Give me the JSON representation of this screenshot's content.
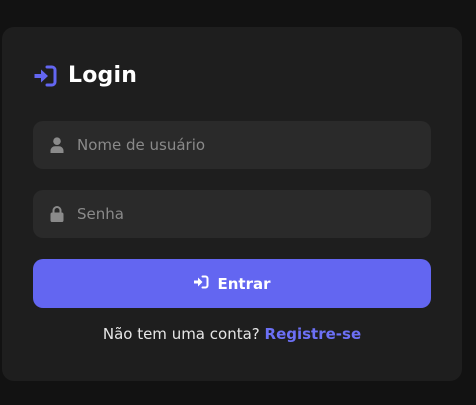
{
  "login": {
    "title": "Login",
    "icon": "sign-in-icon",
    "accent_color": "#6366f1"
  },
  "username": {
    "placeholder": "Nome de usuário",
    "value": "",
    "icon": "user-icon"
  },
  "password": {
    "placeholder": "Senha",
    "value": "",
    "icon": "lock-icon"
  },
  "submit": {
    "label": "Entrar",
    "icon": "sign-in-icon"
  },
  "footer": {
    "text": "Não tem uma conta?",
    "link_label": "Registre-se"
  }
}
